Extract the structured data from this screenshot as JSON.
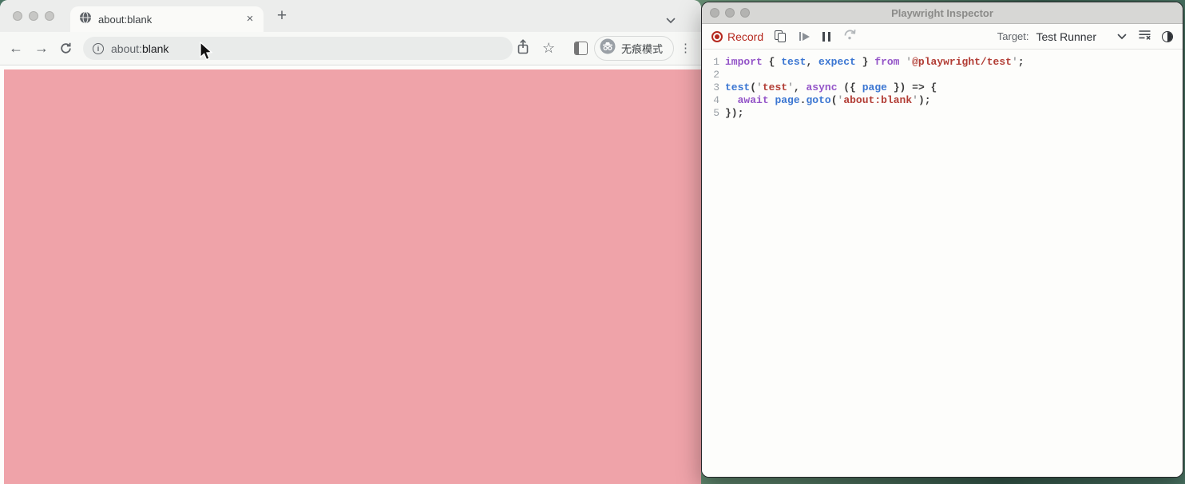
{
  "colors": {
    "page_pink": "#efa3a9",
    "record_red": "#b5281e",
    "code_keyword": "#9455c8",
    "code_ident": "#3b76d2",
    "code_string": "#b23d35",
    "code_quote": "#9a9b9c",
    "code_plain": "#3c3c3c",
    "desktop_green": "#4a7463"
  },
  "glyphs": {
    "back": "←",
    "forward": "→",
    "close": "×",
    "new_tab": "+",
    "star": "☆",
    "kebab": "⋮",
    "info": "i"
  },
  "browser": {
    "tab": {
      "title": "about:blank"
    },
    "toolbar": {
      "url": {
        "scheme": "about:",
        "host": "blank"
      },
      "incognito_label": "无痕模式"
    }
  },
  "inspector": {
    "title": "Playwright Inspector",
    "toolbar": {
      "record_label": "Record",
      "target_label": "Target:",
      "target_value": "Test Runner"
    },
    "code": {
      "lines": [
        {
          "n": "1",
          "tokens": [
            [
              "kw",
              "import"
            ],
            [
              "pl",
              " { "
            ],
            [
              "id",
              "test"
            ],
            [
              "pl",
              ", "
            ],
            [
              "id",
              "expect"
            ],
            [
              "pl",
              " } "
            ],
            [
              "kw",
              "from"
            ],
            [
              "pl",
              " "
            ],
            [
              "q",
              "'"
            ],
            [
              "str",
              "@playwright/test"
            ],
            [
              "q",
              "'"
            ],
            [
              "pl",
              ";"
            ]
          ]
        },
        {
          "n": "2",
          "tokens": []
        },
        {
          "n": "3",
          "tokens": [
            [
              "id",
              "test"
            ],
            [
              "pl",
              "("
            ],
            [
              "q",
              "'"
            ],
            [
              "str",
              "test"
            ],
            [
              "q",
              "'"
            ],
            [
              "pl",
              ", "
            ],
            [
              "kw",
              "async"
            ],
            [
              "pl",
              " ({ "
            ],
            [
              "id",
              "page"
            ],
            [
              "pl",
              " }) => {"
            ]
          ]
        },
        {
          "n": "4",
          "tokens": [
            [
              "pl",
              "  "
            ],
            [
              "kw",
              "await"
            ],
            [
              "pl",
              " "
            ],
            [
              "id",
              "page"
            ],
            [
              "pl",
              "."
            ],
            [
              "id",
              "goto"
            ],
            [
              "pl",
              "("
            ],
            [
              "q",
              "'"
            ],
            [
              "str",
              "about:blank"
            ],
            [
              "q",
              "'"
            ],
            [
              "pl",
              ");"
            ]
          ]
        },
        {
          "n": "5",
          "tokens": [
            [
              "pl",
              "});"
            ]
          ]
        }
      ]
    }
  }
}
